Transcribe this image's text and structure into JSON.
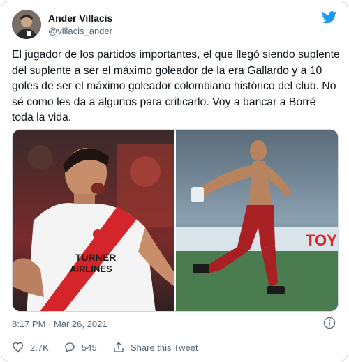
{
  "tweet": {
    "author_name": "Ander Villacis",
    "author_handle": "@villacis_ander",
    "body": "El jugador de los partidos importantes, el que llegó siendo suplente del suplente a ser el máximo goleador de la era Gallardo y a 10 goles de ser el máximo goleador colombiano histórico del club. No sé como les da a algunos para criticarlo. Voy a bancar a Borré toda la vida.",
    "timestamp": "8:17 PM · Mar 26, 2021",
    "media": {
      "left_jersey_text": "TURNER",
      "left_jersey_text_2": "AIRLINES",
      "right_banner_text": "TOY"
    }
  },
  "actions": {
    "likes_count": "2.7K",
    "replies_count": "545",
    "share_label": "Share this Tweet"
  },
  "icons": {
    "logo": "twitter-bird-icon",
    "info": "info-icon",
    "like": "heart-icon",
    "reply": "reply-icon",
    "share": "share-icon"
  },
  "colors": {
    "brand": "#1d9bf0",
    "text": "#0f1419",
    "muted": "#536471",
    "border": "#cfd9de"
  }
}
